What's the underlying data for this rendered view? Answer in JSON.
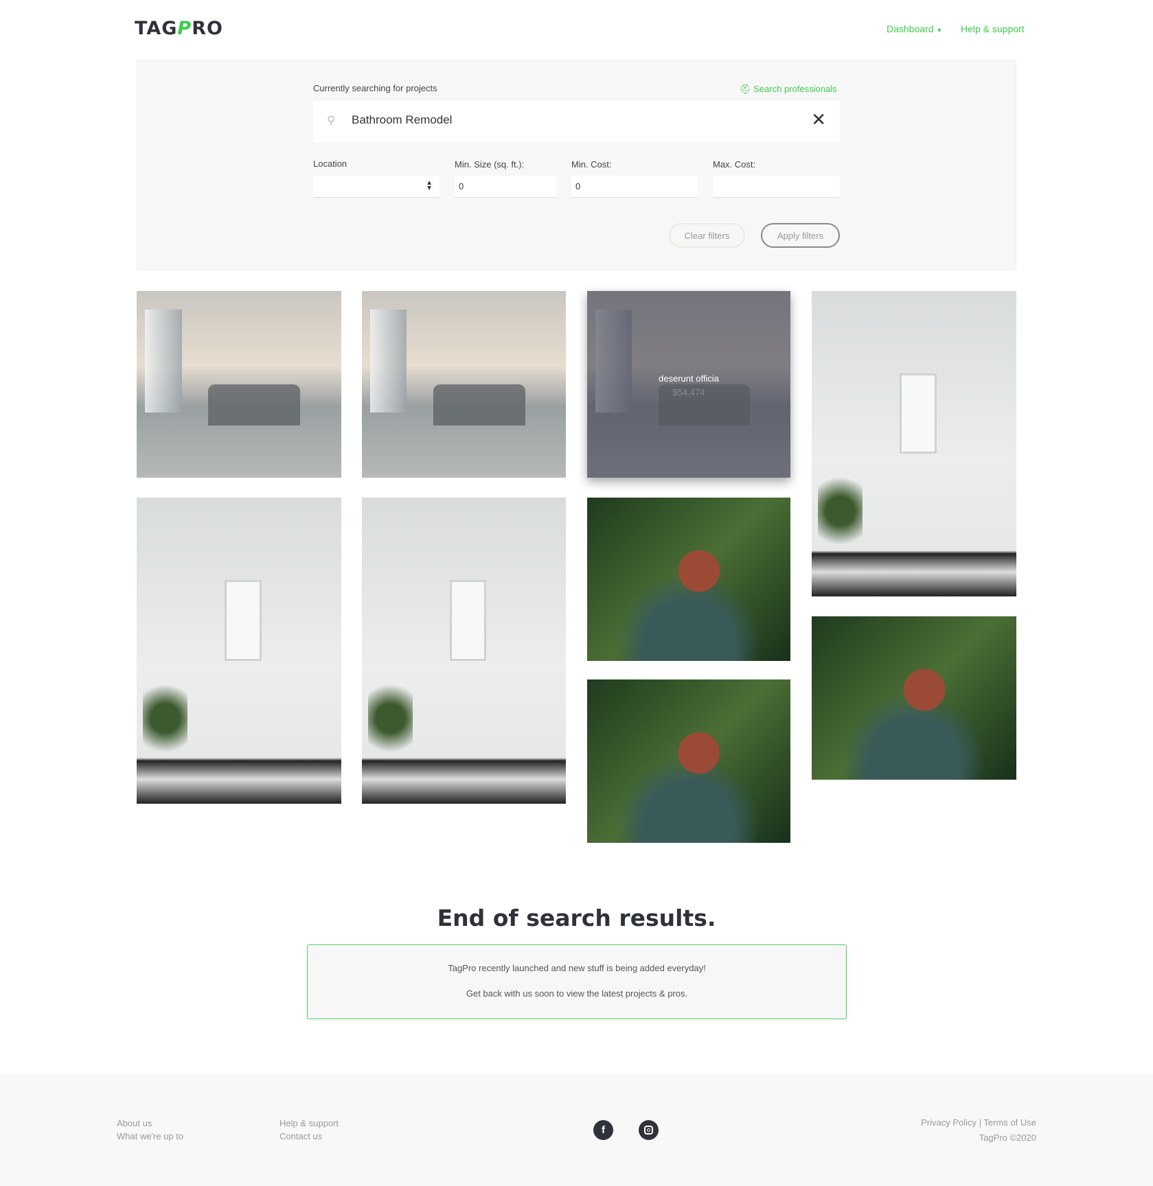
{
  "header": {
    "logo_left": "TAG",
    "logo_p": "P",
    "logo_right": "RO",
    "nav": {
      "dashboard": "Dashboard",
      "help": "Help & support"
    }
  },
  "search": {
    "heading": "Currently searching for projects",
    "search_professionals": "Search professionals",
    "query": "Bathroom Remodel",
    "filters": {
      "location_label": "Location",
      "location_value": "",
      "min_size_label": "Min. Size (sq. ft.):",
      "min_size_value": "0",
      "min_cost_label": "Min. Cost:",
      "min_cost_value": "0",
      "max_cost_label": "Max. Cost:",
      "max_cost_value": ""
    },
    "clear_label": "Clear filters",
    "apply_label": "Apply filters"
  },
  "results": {
    "hovered_card": {
      "title": "deserunt officia",
      "price": "$54,474"
    }
  },
  "end": {
    "title": "End of search results.",
    "line1": "TagPro recently launched and new stuff is being added everyday!",
    "line2": "Get back with us soon to view the latest projects & pros."
  },
  "footer": {
    "about": "About us",
    "what": "What we're up to",
    "help": "Help & support",
    "contact": "Contact us",
    "privacy": "Privacy Policy",
    "separator": "|",
    "terms": "Terms of Use",
    "copyright": "TagPro ©2020"
  },
  "colors": {
    "accent": "#3dcc4e",
    "dark": "#30323b"
  }
}
